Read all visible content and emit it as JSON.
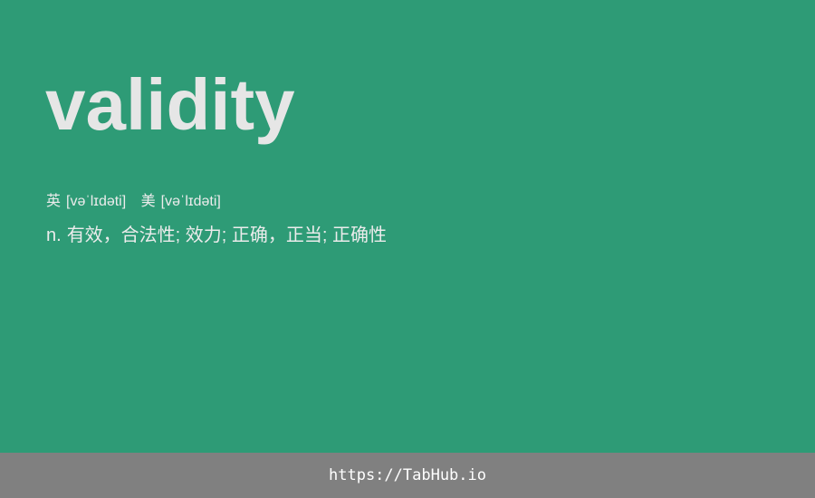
{
  "card": {
    "background_color": "#2e9b76",
    "word": "validity",
    "phonetics": {
      "uk_label": "英",
      "uk_ipa": "[vəˈlɪdəti]",
      "us_label": "美",
      "us_ipa": "[vəˈlɪdəti]"
    },
    "definition": {
      "part_of_speech": "n.",
      "meaning": "有效，合法性; 效力; 正确，正当; 正确性"
    }
  },
  "footer": {
    "background_color": "#808080",
    "link": "https://TabHub.io"
  }
}
